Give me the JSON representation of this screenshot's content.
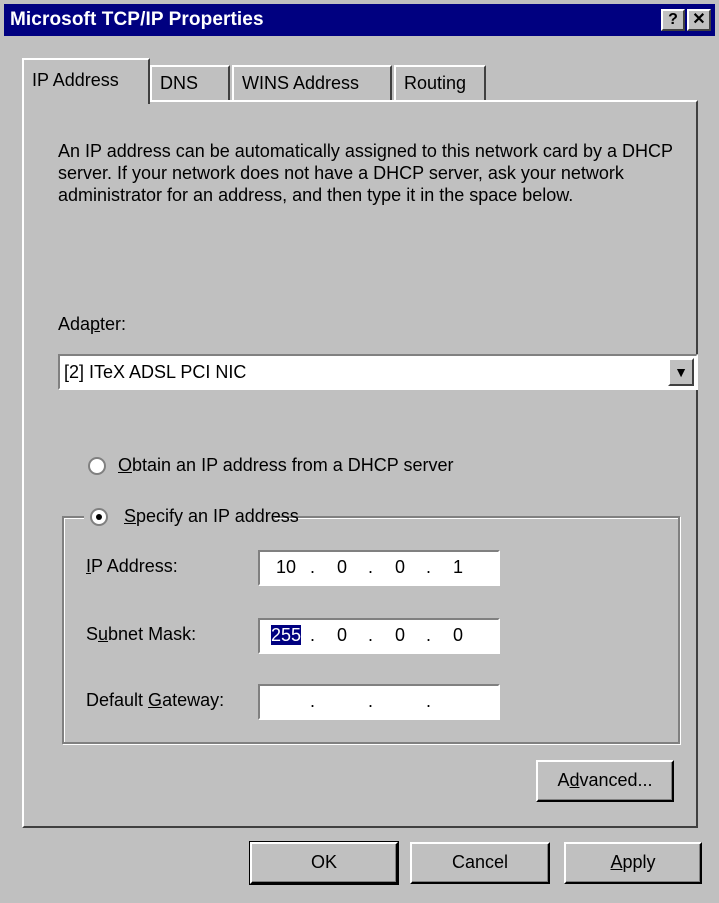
{
  "window": {
    "title": "Microsoft TCP/IP Properties",
    "help_button": "?",
    "close_button": "✕"
  },
  "tabs": [
    {
      "label": "IP Address",
      "active": true
    },
    {
      "label": "DNS",
      "active": false
    },
    {
      "label": "WINS Address",
      "active": false
    },
    {
      "label": "Routing",
      "active": false
    }
  ],
  "description": "An IP address can be automatically assigned to this network card by a DHCP server.  If your network does not have a DHCP server, ask your network administrator for an address, and then type it in the space below.",
  "adapter": {
    "label_pre": "Ada",
    "label_accel": "p",
    "label_post": "ter:",
    "value": "[2] ITeX ADSL PCI NIC",
    "arrow_icon": "▼"
  },
  "radio_dhcp": {
    "accel": "O",
    "rest": "btain an IP address from a DHCP server",
    "checked": false
  },
  "radio_specify": {
    "accel": "S",
    "rest": "pecify an IP address",
    "checked": true
  },
  "ip_address": {
    "label_accel": "I",
    "label_rest": "P Address:",
    "octets": [
      "10",
      "0",
      "0",
      "1"
    ]
  },
  "subnet_mask": {
    "label_pre": "S",
    "label_accel": "u",
    "label_post": "bnet Mask:",
    "octets": [
      "255",
      "0",
      "0",
      "0"
    ]
  },
  "default_gateway": {
    "label_pre": "Default ",
    "label_accel": "G",
    "label_post": "ateway:",
    "octets": [
      "",
      "",
      "",
      ""
    ]
  },
  "separator": ".",
  "buttons": {
    "advanced_pre": "A",
    "advanced_accel": "d",
    "advanced_post": "vanced...",
    "ok": "OK",
    "cancel": "Cancel",
    "apply_accel": "A",
    "apply_rest": "pply"
  }
}
